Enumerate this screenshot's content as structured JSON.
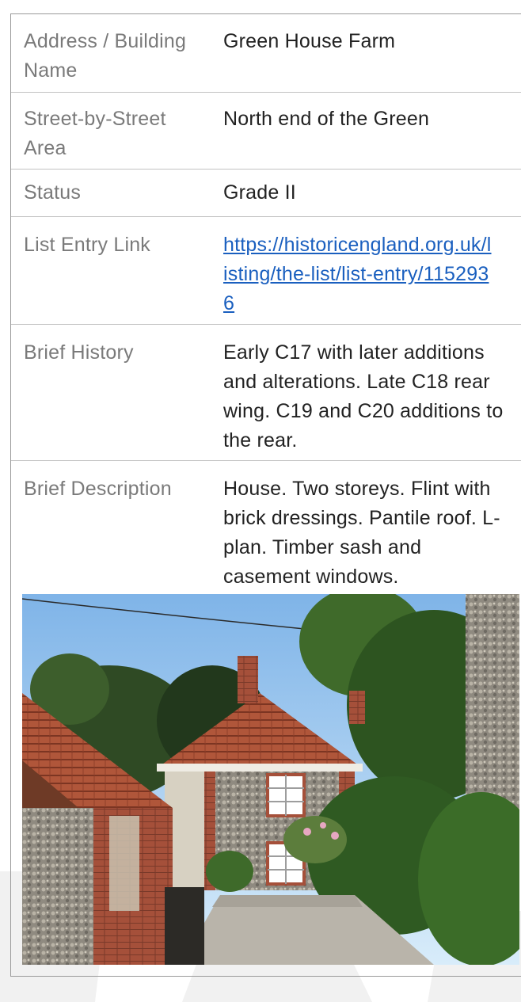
{
  "rows": [
    {
      "label": "Address / Building Name",
      "value": "Green House Farm"
    },
    {
      "label": "Street-by-Street Area",
      "value": "North end of the Green"
    },
    {
      "label": "Status",
      "value": "Grade II"
    },
    {
      "label": "List Entry Link",
      "value": "https://historicengland.org.uk/listing/the-list/list-entry/1152936"
    },
    {
      "label": "Brief History",
      "value": "Early C17 with later additions and alterations. Late C18 rear wing. C19 and C20 additions to the rear."
    },
    {
      "label": "Brief Description",
      "value": "House. Two storeys. Flint with brick dressings. Pantile roof. L-plan. Timber sash and casement windows."
    }
  ],
  "colors": {
    "link": "#1a5fbf",
    "label": "#7a7a7a",
    "value": "#222222",
    "border": "#9a9a9a"
  }
}
